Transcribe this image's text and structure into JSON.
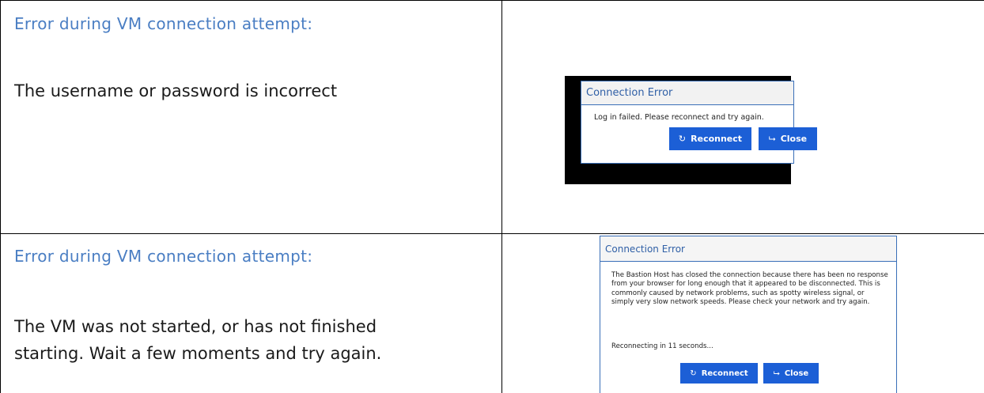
{
  "rows": [
    {
      "heading": "Error during VM connection attempt:",
      "description": "The username or password is incorrect",
      "dialog": {
        "title": "Connection Error",
        "message": "Log in failed. Please reconnect and try again.",
        "reconnect_label": "Reconnect",
        "close_label": "Close"
      }
    },
    {
      "heading": "Error during VM connection attempt:",
      "description": "The VM was not started, or has not finished starting.  Wait a few moments and try again.",
      "dialog": {
        "title": "Connection Error",
        "message": "The Bastion Host has closed the connection because there has been no response from your browser for long enough that it appeared to be disconnected. This is commonly caused by network problems, such as spotty wireless signal, or simply very slow network speeds. Please check your network and try again.",
        "countdown": "Reconnecting in 11 seconds...",
        "reconnect_label": "Reconnect",
        "close_label": "Close"
      }
    }
  ],
  "icons": {
    "reconnect": "refresh-icon",
    "close": "exit-door-icon"
  },
  "colors": {
    "heading": "#4a7ec3",
    "button": "#1c5fd6",
    "dialog_title": "#2f5fa6"
  }
}
